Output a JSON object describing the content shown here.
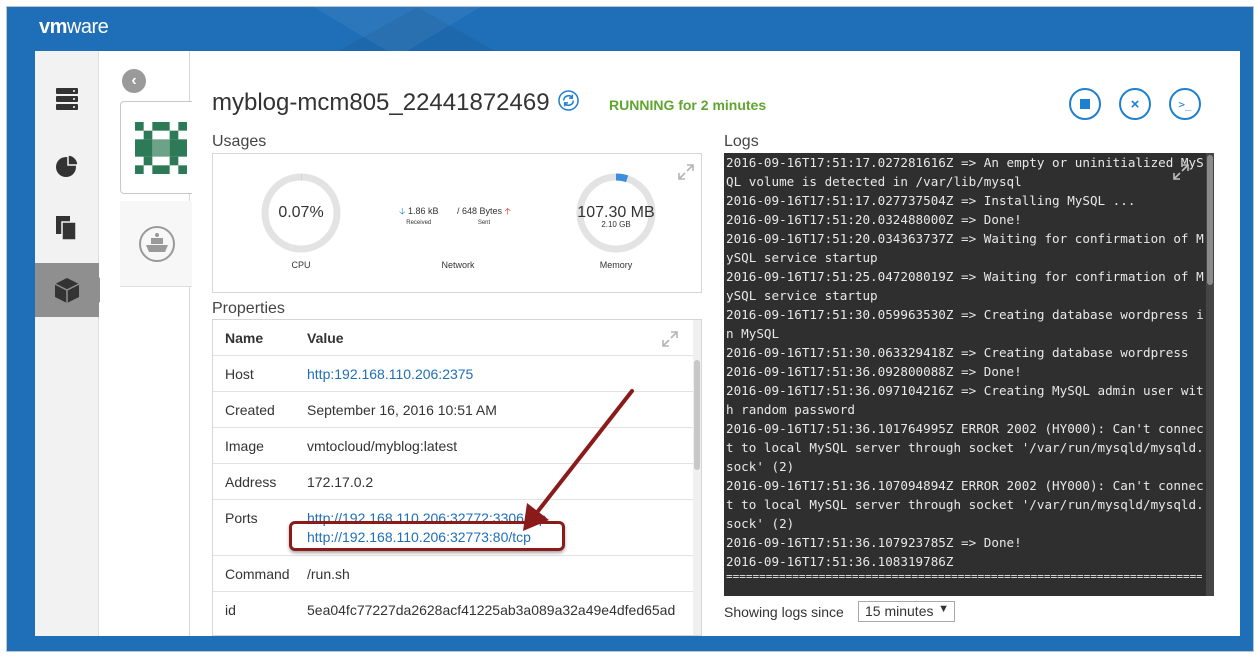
{
  "brand": {
    "vm": "vm",
    "ware": "ware"
  },
  "container": {
    "name": "myblog-mcm805_22441872469",
    "status": "RUNNING for 2 minutes"
  },
  "sections": {
    "usages": "Usages",
    "properties": "Properties",
    "logs": "Logs"
  },
  "usages": {
    "cpu": {
      "value": "0.07%",
      "label": "CPU",
      "fraction": 0.0007
    },
    "network": {
      "received_value": "1.86 kB",
      "received_label": "Received",
      "sent_value": "/ 648 Bytes",
      "sent_label": "Sent",
      "label": "Network"
    },
    "memory": {
      "value": "107.30 MB",
      "limit": "2.10 GB",
      "label": "Memory",
      "fraction": 0.05
    }
  },
  "properties": {
    "headers": {
      "name": "Name",
      "value": "Value"
    },
    "host": {
      "key": "Host",
      "value": "http:192.168.110.206:2375"
    },
    "created": {
      "key": "Created",
      "value": "September 16, 2016 10:51 AM"
    },
    "image": {
      "key": "Image",
      "value": "vmtocloud/myblog:latest"
    },
    "address": {
      "key": "Address",
      "value": "172.17.0.2"
    },
    "ports": {
      "key": "Ports",
      "value1": "http://192.168.110.206:32772:3306/tcp",
      "value2": "http://192.168.110.206:32773:80/tcp"
    },
    "command": {
      "key": "Command",
      "value": "/run.sh"
    },
    "id": {
      "key": "id",
      "value": "5ea04fc77227da2628acf41225ab3a089a32a49e4dfed65ad"
    }
  },
  "logs": {
    "text": "2016-09-16T17:51:17.027281616Z => An empty or uninitialized MySQL volume is detected in /var/lib/mysql\n2016-09-16T17:51:17.027737504Z => Installing MySQL ...\n2016-09-16T17:51:20.032488000Z => Done!\n2016-09-16T17:51:20.034363737Z => Waiting for confirmation of MySQL service startup\n2016-09-16T17:51:25.047208019Z => Waiting for confirmation of MySQL service startup\n2016-09-16T17:51:30.059963530Z => Creating database wordpress in MySQL\n2016-09-16T17:51:30.063329418Z => Creating database wordpress\n2016-09-16T17:51:36.092800088Z => Done!\n2016-09-16T17:51:36.097104216Z => Creating MySQL admin user with random password\n2016-09-16T17:51:36.101764995Z ERROR 2002 (HY000): Can't connect to local MySQL server through socket '/var/run/mysqld/mysqld.sock' (2)\n2016-09-16T17:51:36.107094894Z ERROR 2002 (HY000): Can't connect to local MySQL server through socket '/var/run/mysqld/mysqld.sock' (2)\n2016-09-16T17:51:36.107923785Z => Done!\n2016-09-16T17:51:36.108319786Z",
    "separator": "================================================================================================",
    "since_label": "Showing logs since",
    "since_value": "15 minutes"
  },
  "icons": {
    "rail": [
      "server-stack-icon",
      "pie-chart-icon",
      "copy-icon",
      "package-icon"
    ],
    "actions": [
      "stop-icon",
      "remove-icon",
      "console-icon"
    ]
  },
  "colors": {
    "header": "#1f6fb8",
    "accent": "#1f7fd1",
    "running": "#5fa62f",
    "annotation": "#8b1a1a"
  }
}
